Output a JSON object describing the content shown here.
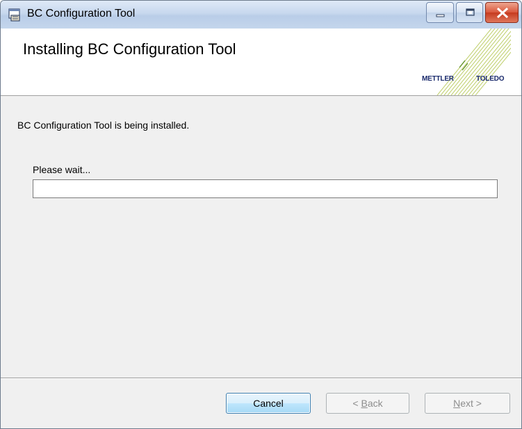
{
  "window": {
    "title": "BC Configuration Tool",
    "controls": {
      "minimize": "minimize-icon",
      "maximize": "maximize-icon",
      "close": "close-icon"
    }
  },
  "header": {
    "title": "Installing BC Configuration Tool",
    "logo": {
      "left_text": "METTLER",
      "right_text": "TOLEDO"
    }
  },
  "body": {
    "message": "BC Configuration Tool is being installed.",
    "wait_label": "Please wait...",
    "progress": 0
  },
  "buttons": {
    "cancel": "Cancel",
    "back_prefix": "< ",
    "back_accel": "B",
    "back_rest": "ack",
    "next_accel": "N",
    "next_rest": "ext >"
  },
  "colors": {
    "progress_fill": "#06b025",
    "logo_text": "#1a2a6c",
    "logo_lines": "#b7c95a"
  }
}
